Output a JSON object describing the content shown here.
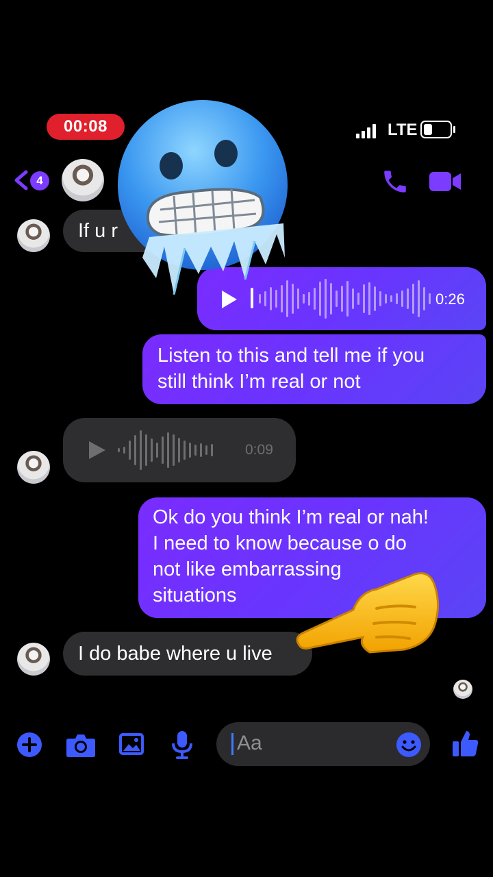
{
  "status": {
    "recording_time": "00:08",
    "network": "LTE"
  },
  "header": {
    "unread_count": "4"
  },
  "messages": [
    {
      "dir": "in",
      "type": "text",
      "text": "If u r"
    },
    {
      "dir": "out",
      "type": "audio",
      "duration": "0:26"
    },
    {
      "dir": "out",
      "type": "text",
      "lines": [
        "Listen to this and tell me if you",
        "still think I’m real or not"
      ]
    },
    {
      "dir": "in",
      "type": "audio",
      "duration": "0:09"
    },
    {
      "dir": "out",
      "type": "text",
      "lines": [
        "Ok do you think I’m real or nah!",
        "I need to know because o do",
        "not like embarrassing",
        "situations"
      ]
    },
    {
      "dir": "in",
      "type": "text",
      "text": "I do babe where u live"
    }
  ],
  "composer": {
    "placeholder": "Aa"
  },
  "stickers": [
    "cold-face-emoji",
    "backhand-index-pointing-left-emoji"
  ],
  "colors": {
    "accent": "#7b3cff",
    "recording": "#e0202c",
    "incoming_bubble": "#2e2e30",
    "outgoing_bubble": "#6a34ff",
    "composer_icon": "#3d5afe"
  }
}
